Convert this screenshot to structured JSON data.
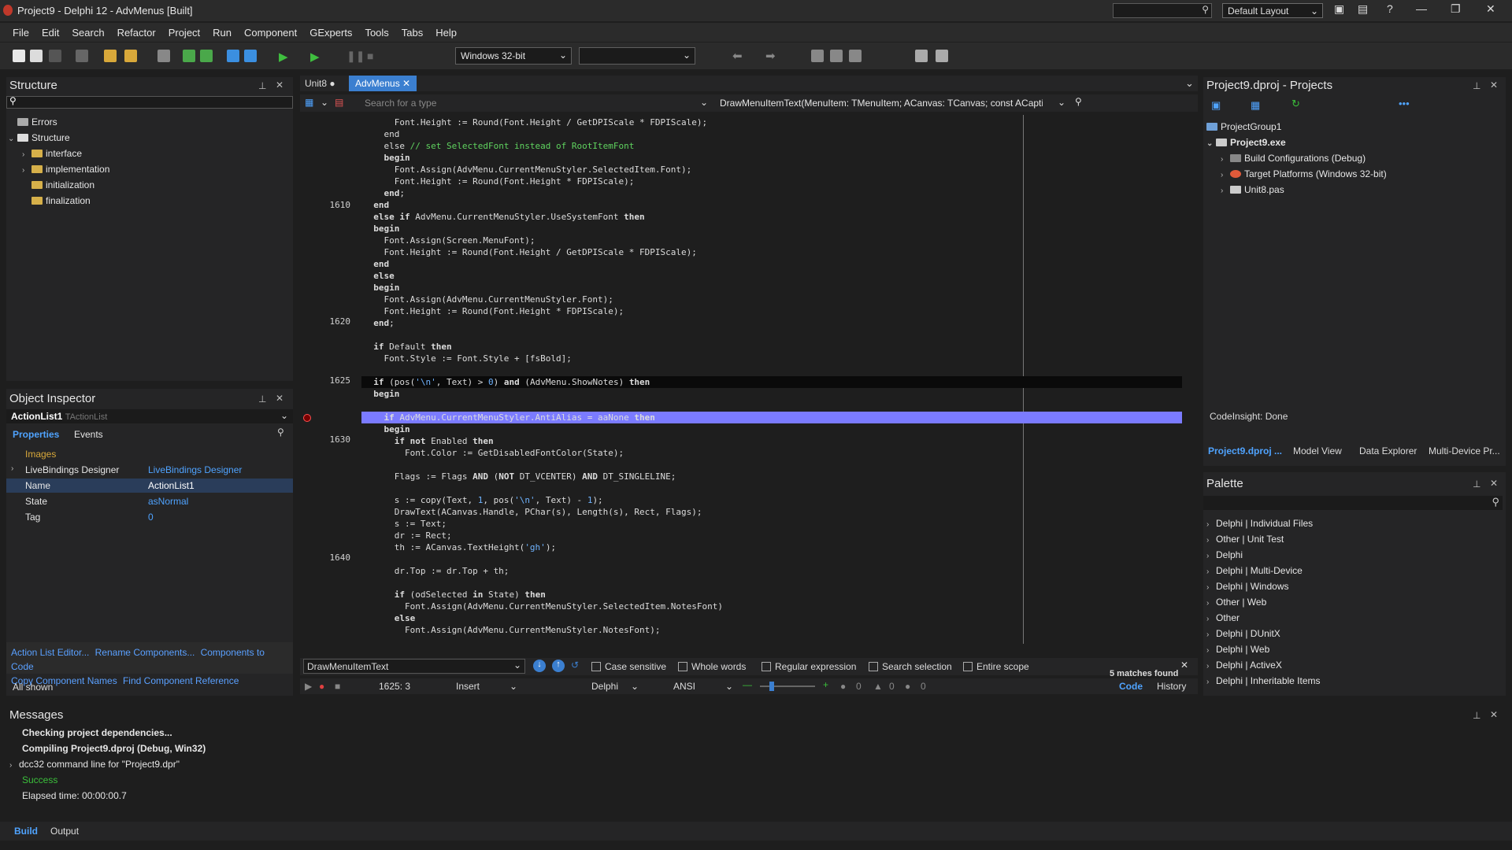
{
  "window": {
    "title": "Project9 - Delphi 12 - AdvMenus [Built]",
    "layout": "Default Layout"
  },
  "menu": [
    "File",
    "Edit",
    "Search",
    "Refactor",
    "Project",
    "Run",
    "Component",
    "GExperts",
    "Tools",
    "Tabs",
    "Help"
  ],
  "toolbar": {
    "platform": "Windows 32-bit",
    "config": ""
  },
  "structure": {
    "title": "Structure",
    "items": [
      {
        "label": "Errors"
      },
      {
        "label": "Structure"
      },
      {
        "label": "interface"
      },
      {
        "label": "implementation"
      },
      {
        "label": "initialization"
      },
      {
        "label": "finalization"
      }
    ]
  },
  "inspector": {
    "title": "Object Inspector",
    "object": "ActionList1",
    "objtype": "TActionList",
    "tabs": [
      "Properties",
      "Events"
    ],
    "rows": [
      {
        "name": "Images",
        "value": ""
      },
      {
        "name": "LiveBindings Designer",
        "value": "LiveBindings Designer"
      },
      {
        "name": "Name",
        "value": "ActionList1"
      },
      {
        "name": "State",
        "value": "asNormal"
      },
      {
        "name": "Tag",
        "value": "0"
      }
    ],
    "links": [
      "Action List Editor...",
      "Rename Components...",
      "Components to Code",
      "Copy Component Names",
      "Find Component Reference"
    ],
    "footer": "All shown"
  },
  "editor": {
    "tabs": [
      {
        "label": "Unit8"
      },
      {
        "label": "AdvMenus"
      }
    ],
    "type_search": "Search for a type",
    "method": "DrawMenuItemText(MenuItem: TMenuItem; ACanvas: TCanvas; const ACaptior",
    "line_numbers": [
      "1610",
      "1620",
      "1625",
      "1630",
      "1640"
    ],
    "find_text": "DrawMenuItemText",
    "options": [
      "Case sensitive",
      "Whole words",
      "Regular expression",
      "Search selection",
      "Entire scope"
    ],
    "matches": "5 matches found",
    "views": [
      "Code",
      "History"
    ],
    "status": {
      "pos": "1625: 3",
      "mode": "Insert",
      "lang": "Delphi",
      "enc": "ANSI",
      "c1": "0",
      "c2": "0",
      "c3": "0"
    }
  },
  "projects": {
    "title": "Project9.dproj - Projects",
    "items": [
      "ProjectGroup1",
      "Project9.exe",
      "Build Configurations (Debug)",
      "Target Platforms (Windows 32-bit)",
      "Unit8.pas"
    ],
    "status": "CodeInsight: Done",
    "tabs": [
      "Project9.dproj ...",
      "Model View",
      "Data Explorer",
      "Multi-Device Pr..."
    ]
  },
  "palette": {
    "title": "Palette",
    "items": [
      "Delphi | Individual Files",
      "Other | Unit Test",
      "Delphi",
      "Delphi | Multi-Device",
      "Delphi | Windows",
      "Other | Web",
      "Other",
      "Delphi | DUnitX",
      "Delphi | Web",
      "Delphi | ActiveX",
      "Delphi | Inheritable Items"
    ]
  },
  "messages": {
    "title": "Messages",
    "lines": [
      "Checking project dependencies...",
      "Compiling Project9.dproj (Debug, Win32)",
      "dcc32 command line for \"Project9.dpr\"",
      "Success",
      "Elapsed time: 00:00:00.7"
    ],
    "tabs": [
      "Build",
      "Output"
    ]
  },
  "colors": {
    "accent": "#3b8fe0",
    "highlight": "#7b7bff",
    "bg": "#1e1e1e"
  }
}
